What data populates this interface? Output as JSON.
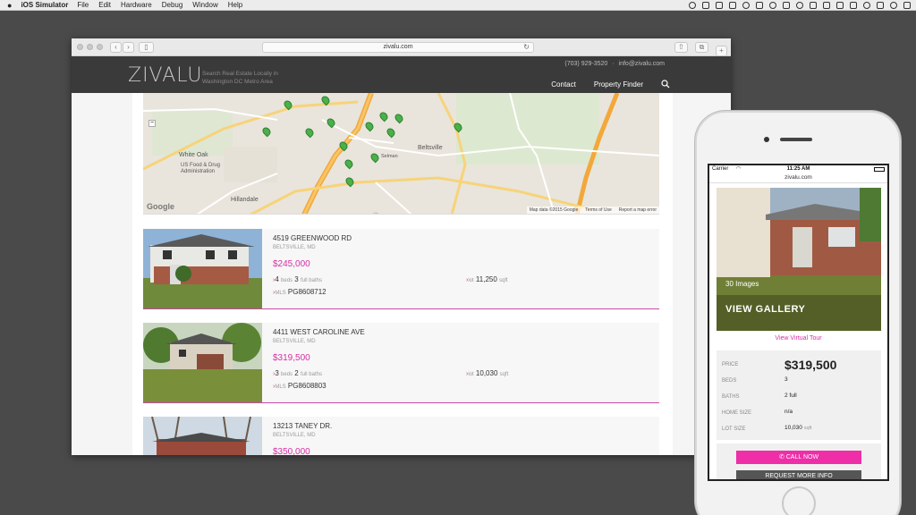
{
  "menubar": {
    "apple": "",
    "app_name": "iOS Simulator",
    "items": [
      "File",
      "Edit",
      "Hardware",
      "Debug",
      "Window",
      "Help"
    ]
  },
  "browser": {
    "url": "zivalu.com"
  },
  "site": {
    "logo": "ZIVALU",
    "tagline": "Search Real Estate Locally in Washington DC Metro Area",
    "phone": "(703) 929-3520",
    "email": "info@zivalu.com",
    "separator": "·",
    "nav": [
      "Contact",
      "Property Finder"
    ]
  },
  "map": {
    "labels": {
      "white_oak": "White Oak",
      "fda": "US Food & Drug Administration",
      "hillandale": "Hillandale",
      "beltsville": "Beltsville",
      "selman": "Selman",
      "google": "Google",
      "attribution": "Map data ©2015 Google",
      "terms": "Terms of Use",
      "report": "Report a map error"
    },
    "pin_count": 14
  },
  "listings": [
    {
      "address": "4519 GREENWOOD RD",
      "city": "BELTSVILLE, MD",
      "price": "$245,000",
      "beds": "4",
      "baths": "3",
      "lot": "11,250",
      "mls": "PG8608712"
    },
    {
      "address": "4411 WEST CAROLINE AVE",
      "city": "BELTSVILLE, MD",
      "price": "$319,500",
      "beds": "3",
      "baths": "2",
      "lot": "10,030",
      "mls": "PG8608803"
    },
    {
      "address": "13213 TANEY DR.",
      "city": "BELTSVILLE, MD",
      "price": "$350,000"
    }
  ],
  "listing_labels": {
    "beds": "beds",
    "baths": "full baths",
    "lot": "lot",
    "sqft": "sqft",
    "mls": "MLS"
  },
  "phone": {
    "carrier": "Carrier",
    "time": "11:25 AM",
    "url": "zivalu.com",
    "images_count": "30 Images",
    "gallery": "VIEW GALLERY",
    "virtual_tour": "View Virtual Tour",
    "details": {
      "price_label": "PRICE",
      "price": "$319,500",
      "beds_label": "BEDS",
      "beds": "3",
      "baths_label": "BATHS",
      "baths": "2 full",
      "home_size_label": "HOME SIZE",
      "home_size": "n/a",
      "lot_size_label": "LOT SIZE",
      "lot_size": "10,030",
      "lot_unit": "sqft"
    },
    "call_now": "CALL NOW",
    "request_info": "REQUEST MORE INFO"
  },
  "colors": {
    "accent": "#d62fa4",
    "header": "#3a3a3a",
    "call_button": "#ee2fa8"
  }
}
